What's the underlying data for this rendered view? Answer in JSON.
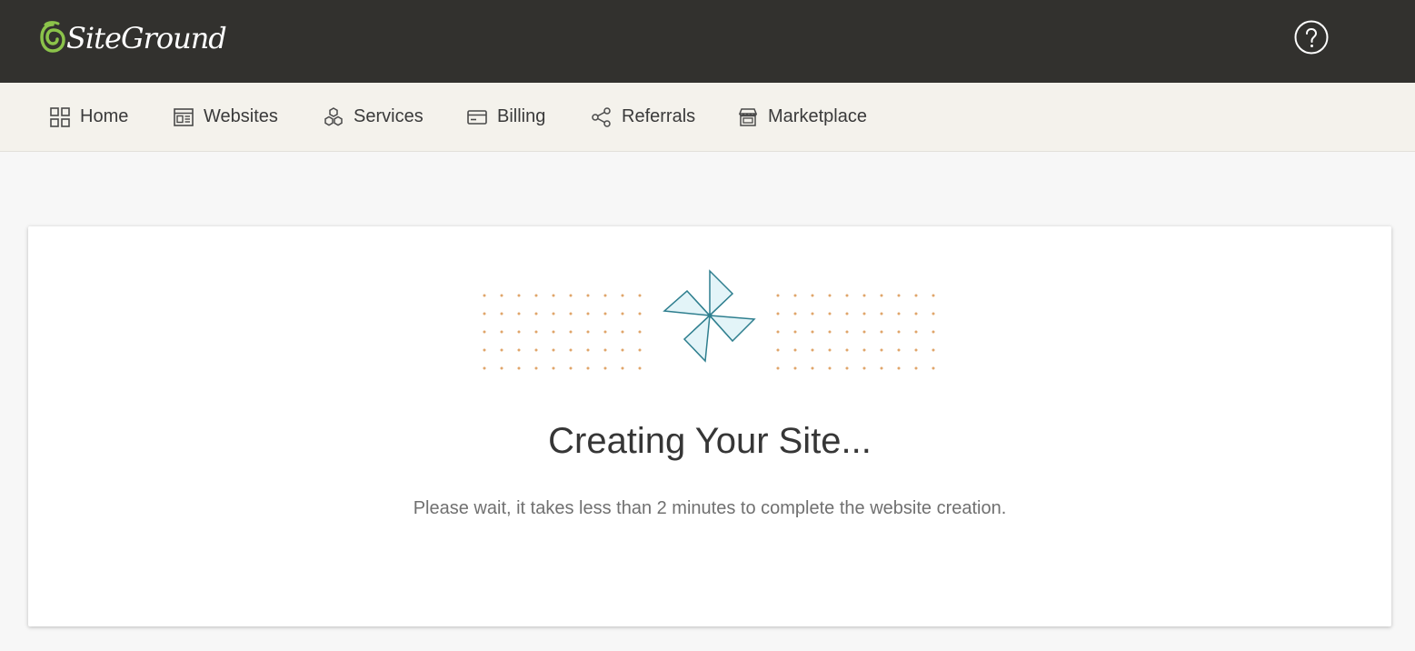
{
  "header": {
    "brand": "SiteGround",
    "brand_color": "#8bc34a",
    "help_icon": "help-circle-icon"
  },
  "nav": {
    "items": [
      {
        "label": "Home",
        "icon": "grid-icon"
      },
      {
        "label": "Websites",
        "icon": "browser-window-icon"
      },
      {
        "label": "Services",
        "icon": "cubes-icon"
      },
      {
        "label": "Billing",
        "icon": "credit-card-icon"
      },
      {
        "label": "Referrals",
        "icon": "share-nodes-icon"
      },
      {
        "label": "Marketplace",
        "icon": "storefront-icon"
      }
    ]
  },
  "main": {
    "illustration": "pinwheel-icon",
    "title": "Creating Your Site...",
    "subtitle": "Please wait, it takes less than 2 minutes to complete the website creation."
  },
  "colors": {
    "topbar": "#32312e",
    "navbar": "#f4f2ec",
    "dot_accent": "#e0a56a",
    "pinwheel_fill": "#e3f4f8",
    "pinwheel_stroke": "#2f7f8f"
  }
}
